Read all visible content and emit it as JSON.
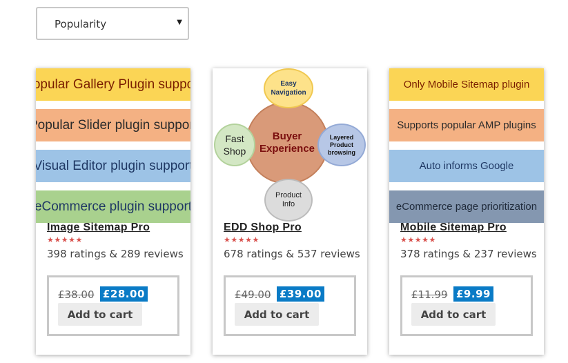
{
  "sort": {
    "selected": "Popularity"
  },
  "products": [
    {
      "title": "Image Sitemap Pro",
      "stars": "★★★★★",
      "ratings": "398 ratings & 289 reviews",
      "old_price": "£38.00",
      "new_price": "£28.00",
      "cart_label": "Add to cart",
      "image_bands": [
        {
          "text": "Popular Gallery Plugin support",
          "color": "#fbd555"
        },
        {
          "text": "Popular Slider plugin support",
          "color": "#f4b183"
        },
        {
          "text": "Visual Editor plugin support",
          "color": "#9dc3e6"
        },
        {
          "text": "eCommerce plugin support",
          "color": "#a9d18e"
        }
      ]
    },
    {
      "title": "EDD Shop Pro",
      "stars": "★★★★★",
      "ratings": "678 ratings & 537 reviews",
      "old_price": "£49.00",
      "new_price": "£39.00",
      "cart_label": "Add to cart",
      "diagram": {
        "center": "Buyer Experience",
        "top": "Easy Navigation",
        "left": "Fast Shop",
        "right": "Layered Product browsing",
        "bottom": "Product Info"
      }
    },
    {
      "title": "Mobile Sitemap Pro",
      "stars": "★★★★★",
      "ratings": "378 ratings & 237 reviews",
      "old_price": "£11.99",
      "new_price": "£9.99",
      "cart_label": "Add to cart",
      "image_bands": [
        {
          "text": "Only Mobile Sitemap plugin",
          "color": "#fbd555"
        },
        {
          "text": "Supports popular AMP plugins",
          "color": "#f4b183"
        },
        {
          "text": "Auto informs Google",
          "color": "#9dc3e6"
        },
        {
          "text": "eCommerce page prioritization",
          "color": "#8497b0"
        }
      ]
    }
  ]
}
